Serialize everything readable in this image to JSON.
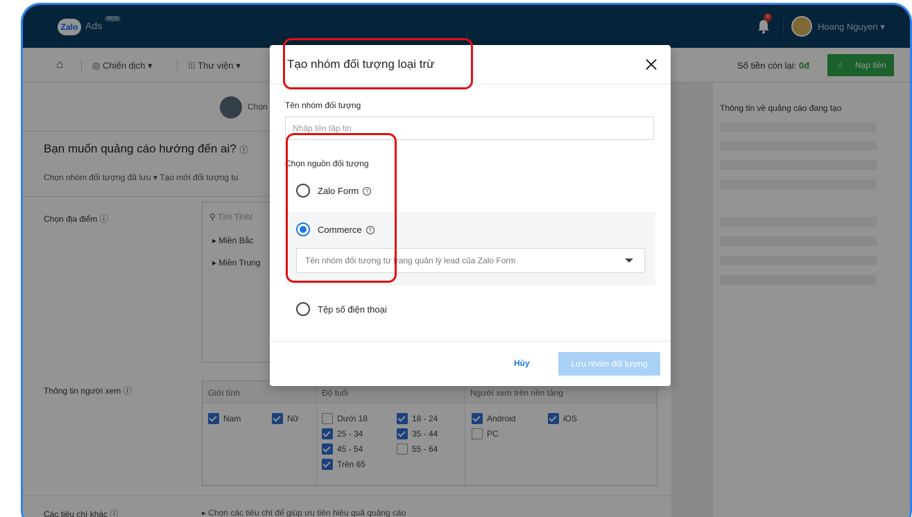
{
  "topbar": {
    "logo_text": "Zalo",
    "ads_text": "Ads",
    "beta_text": "BETA",
    "notification_count": "8",
    "user_name": "Hoang Nguyen"
  },
  "navbar": {
    "home_icon": "home-icon",
    "campaign_label": "Chiến dịch",
    "library_label": "Thư viện",
    "balance_label": "Số tiền còn lại:",
    "balance_value": "0đ",
    "topup_label": "Nạp tiền"
  },
  "content": {
    "step_label": "Chọn",
    "question_title": "Bạn muốn quảng cáo hướng đến ai?",
    "saved_audience_label": "Chọn nhóm đối tượng đã lưu",
    "create_new_label": "Tạo mới đối tượng tu",
    "location_label": "Chọn địa điểm",
    "location_search_placeholder": "Tìm Tỉnh/",
    "location_items": [
      "Miền Bắc",
      "Miền Trung"
    ],
    "viewer_info_label": "Thông tin người xem",
    "viewer_headers": [
      "Giới tính",
      "Độ tuổi",
      "Người xem trên nền tảng"
    ],
    "gender": [
      {
        "label": "Nam",
        "checked": true
      },
      {
        "label": "Nữ",
        "checked": true
      }
    ],
    "ages": [
      {
        "label": "Dưới 18",
        "checked": false
      },
      {
        "label": "18 - 24",
        "checked": true
      },
      {
        "label": "25 - 34",
        "checked": true
      },
      {
        "label": "35 - 44",
        "checked": true
      },
      {
        "label": "45 - 54",
        "checked": true
      },
      {
        "label": "55 - 64",
        "checked": false
      },
      {
        "label": "Trên 65",
        "checked": true
      }
    ],
    "platforms": [
      {
        "label": "Android",
        "checked": true
      },
      {
        "label": "iOS",
        "checked": true
      },
      {
        "label": "PC",
        "checked": false
      }
    ],
    "other_criteria_label": "Các tiêu chí khác",
    "other_criteria_text": "Chọn các tiêu chí để giúp ưu tiên hiệu quả quảng cáo"
  },
  "sidepanel": {
    "title": "Thông tin về quảng cáo đang tạo"
  },
  "modal": {
    "title": "Tạo nhóm đối tượng loại trừ",
    "name_label": "Tên nhóm đối tượng",
    "name_placeholder": "Nhập tên tập tin",
    "source_label": "Chọn nguồn đối tượng",
    "options": [
      {
        "label": "Zalo Form",
        "selected": false
      },
      {
        "label": "Commerce",
        "selected": true
      },
      {
        "label": "Tệp số điện thoại",
        "selected": false
      }
    ],
    "select_placeholder": "Tên nhóm đối tượng từ trang quản lý lead của Zalo Form",
    "cancel_label": "Hủy",
    "save_label": "Lưu nhóm đối tượng"
  },
  "colors": {
    "topbar": "#0a3d62",
    "primary_blue": "#1b7bdc",
    "topup_green": "#2ea84a",
    "annotation_red": "#e01010"
  }
}
